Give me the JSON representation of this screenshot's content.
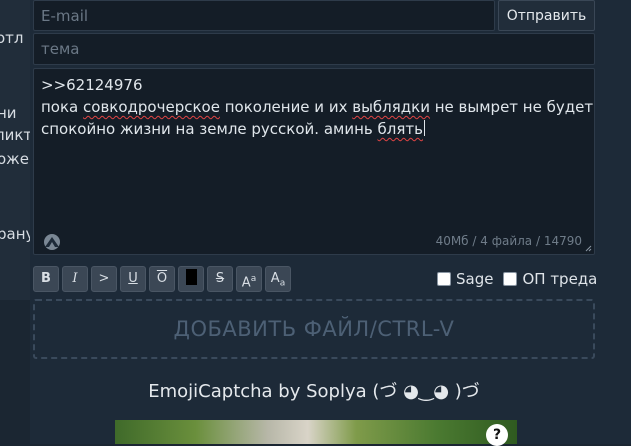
{
  "background_fragments": [
    "отл",
    "ни",
    "ликт",
    "оже",
    "рану"
  ],
  "form": {
    "email_placeholder": "E-mail",
    "submit_label": "Отправить",
    "subject_placeholder": "тема",
    "message": {
      "reply_ref": ">>62124976",
      "line1_words": [
        "пока",
        "совкодрочерское",
        "поколение и их",
        "выблядки",
        "не вымрет не будет"
      ],
      "line2_words": [
        "спокойно жизни на земле русской. аминь",
        "блять"
      ]
    },
    "counter": "40Мб / 4 файла / 14790"
  },
  "markup_buttons": [
    "B",
    "I",
    ">",
    "U",
    "O",
    "",
    "S",
    "A",
    "a",
    "A",
    "a"
  ],
  "options": {
    "sage_label": "Sage",
    "op_label": "ОП треда"
  },
  "dropzone_label": "ДОБАВИТЬ ФАЙЛ/CTRL-V",
  "captcha": {
    "title": "EmojiCaptcha by Soplya (づ ◕‿◕ )づ",
    "help": "?"
  },
  "colors": {
    "background": "#1b2632",
    "field_bg": "#141d27",
    "accent_dashed": "#3a4a5c",
    "spellcheck": "#e04444"
  }
}
